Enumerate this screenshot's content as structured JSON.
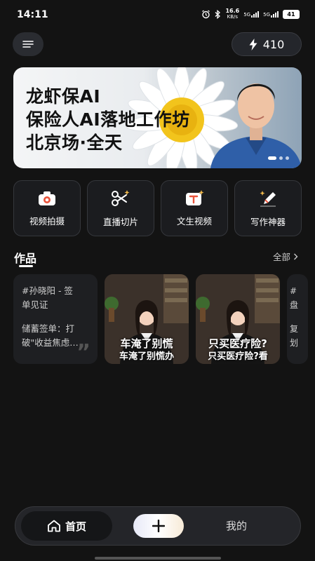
{
  "status_bar": {
    "time": "14:11",
    "net_speed": "16.6",
    "net_unit": "KB/s",
    "sig1": "5G",
    "sig2": "5G",
    "battery": "41"
  },
  "header": {
    "energy_count": "410"
  },
  "banner": {
    "line1": "龙虾保AI",
    "line2": "保险人AI落地工作坊",
    "line3": "北京场·全天",
    "page_count": 3,
    "active_page": 1
  },
  "tools": [
    {
      "label": "视频拍摄",
      "icon": "camera-icon"
    },
    {
      "label": "直播切片",
      "icon": "scissors-sparkle-icon"
    },
    {
      "label": "文生视频",
      "icon": "text-to-video-icon"
    },
    {
      "label": "写作神器",
      "icon": "pen-sparkle-icon"
    }
  ],
  "works": {
    "title": "作品",
    "all_label": "全部",
    "text_card": {
      "line1": "#孙晓阳 - 签",
      "line2": "单见证",
      "line3": "储蓄签单：打",
      "line4": "破\"收益焦虑…"
    },
    "video_cards": [
      {
        "title": "车淹了别慌",
        "subtitle": "车淹了别慌办"
      },
      {
        "title": "只买医疗险?",
        "subtitle": "只买医疗险?看"
      }
    ],
    "partial_card": {
      "line1": "#",
      "line2": "盘",
      "line3": "复",
      "line4": "划"
    }
  },
  "nav": {
    "home_label": "首页",
    "mine_label": "我的"
  },
  "colors": {
    "background": "#131313",
    "card": "#1e1f22",
    "accent_plus": "#f7ead7"
  }
}
